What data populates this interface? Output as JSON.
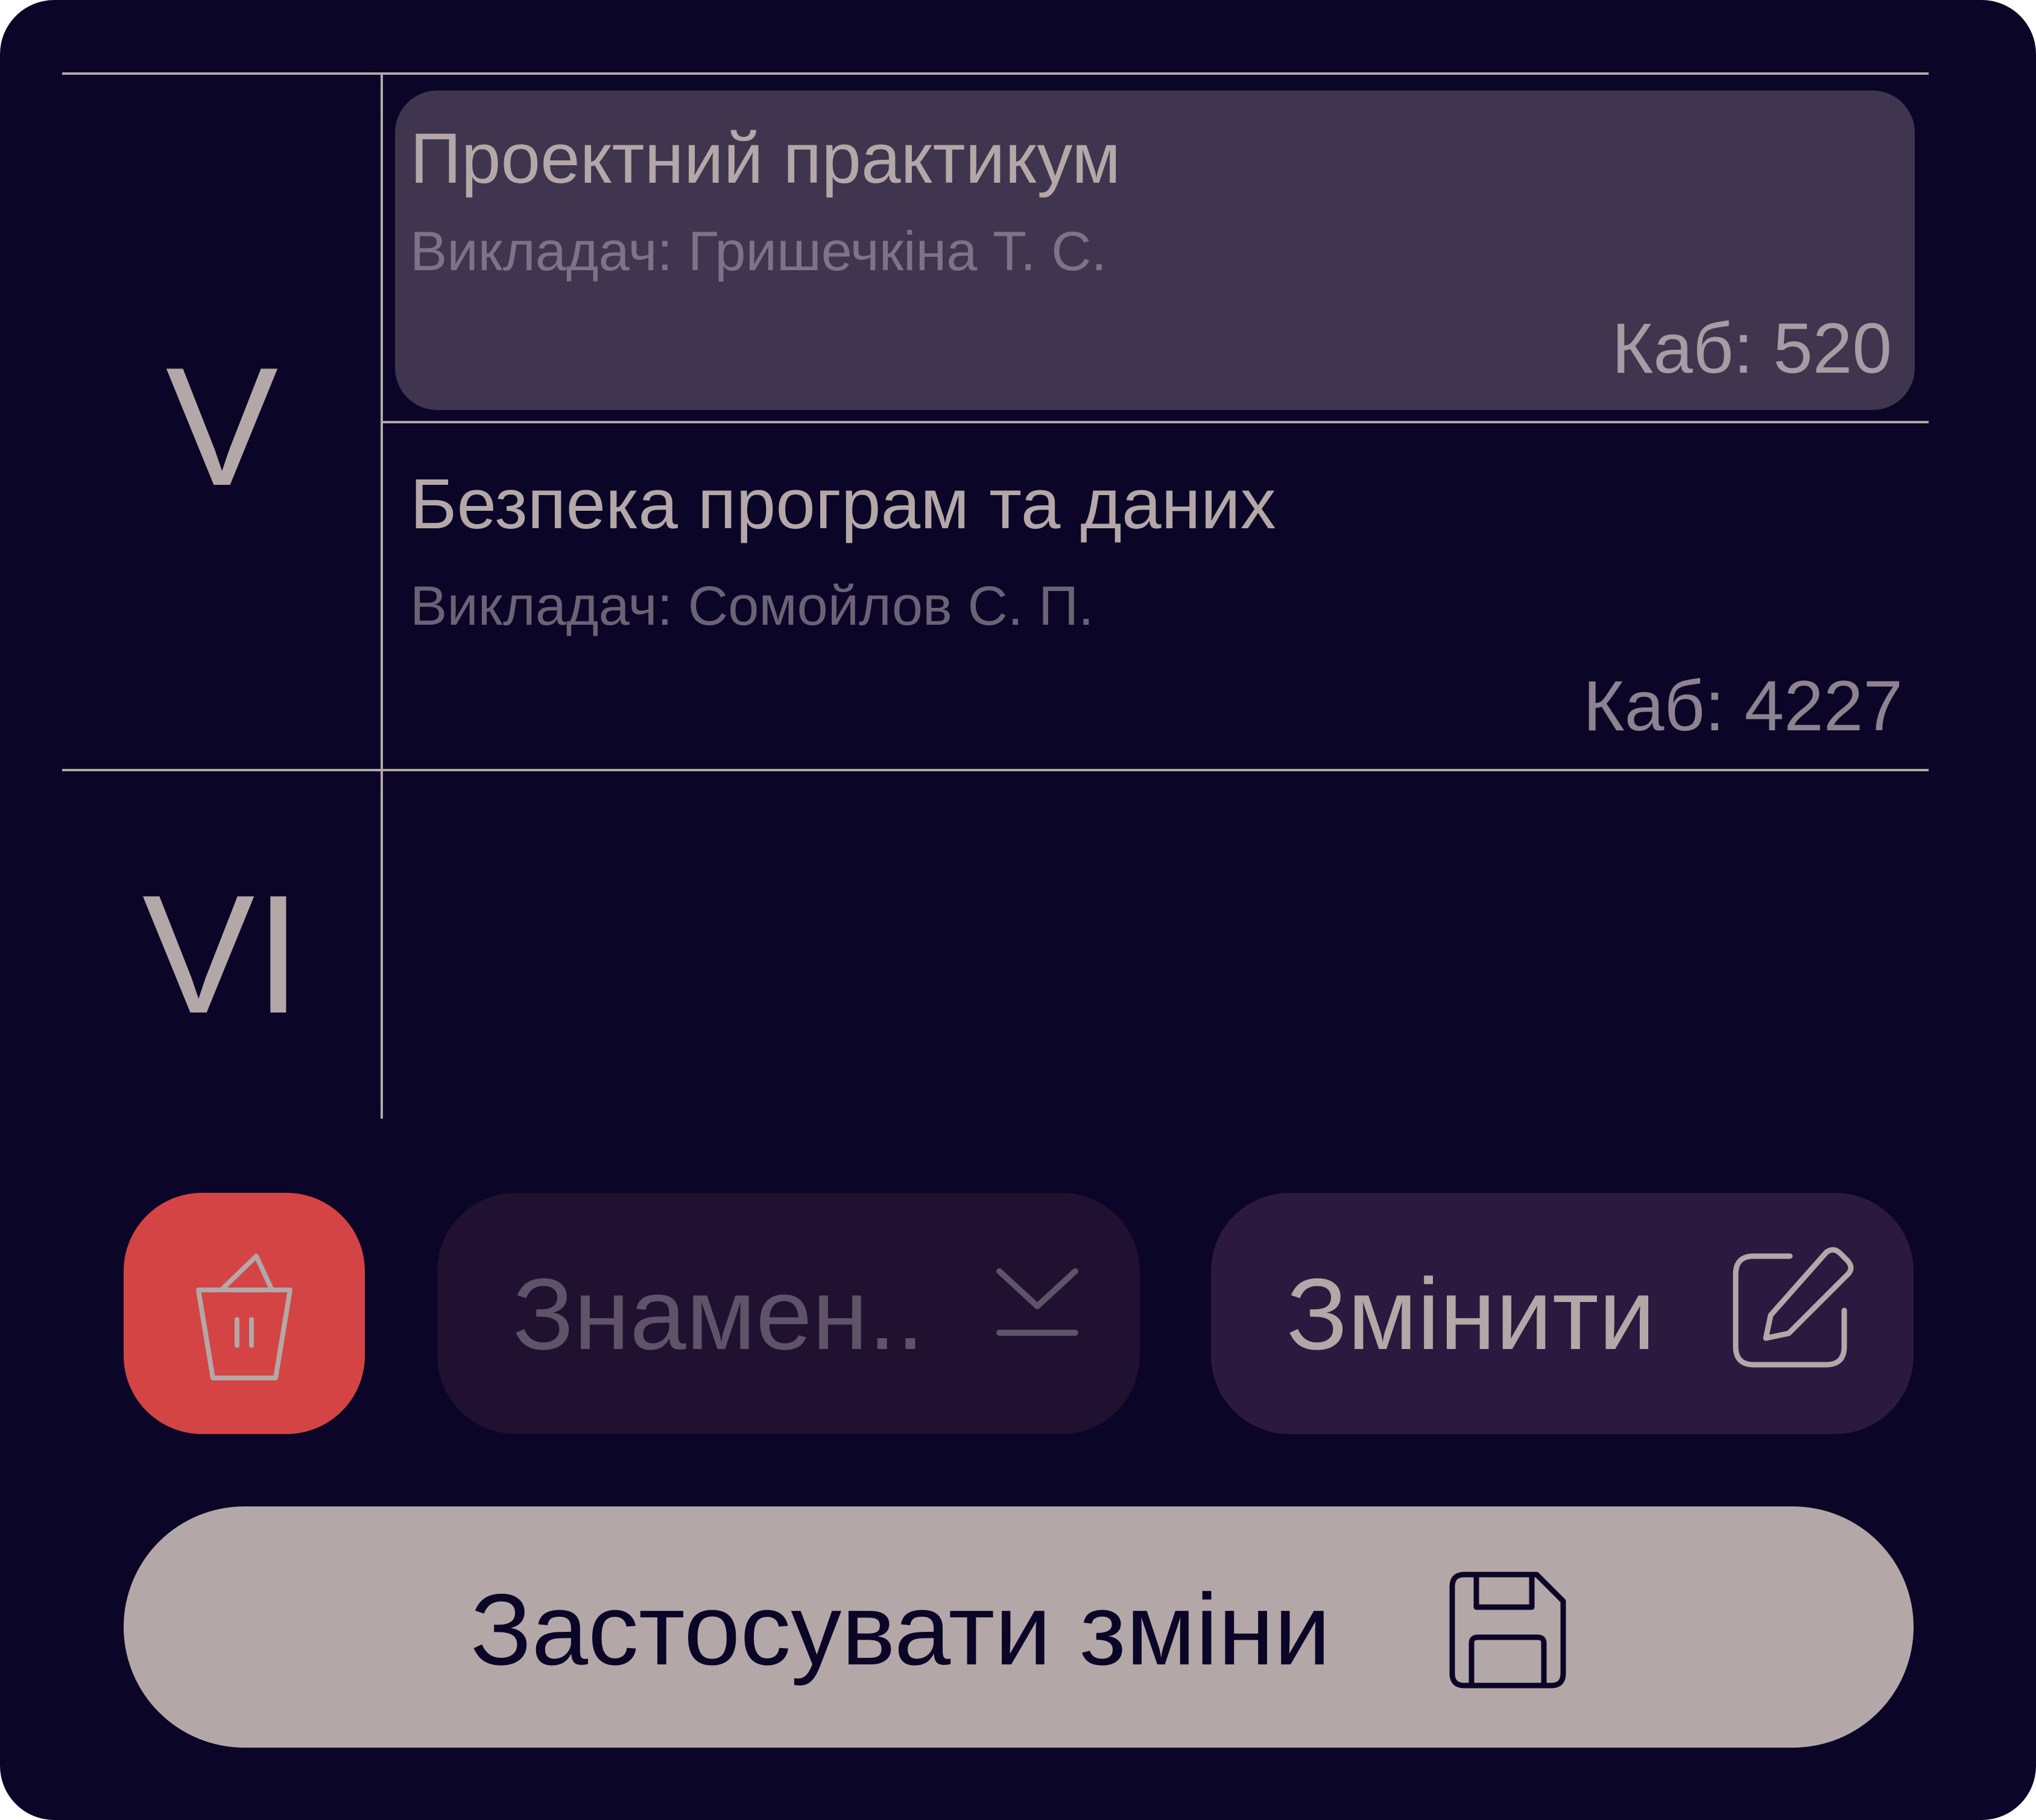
{
  "periods": [
    {
      "label": "V",
      "lessons": [
        {
          "subject": "Проектний практикум",
          "teacher": "Викладач: Гришечкіна Т. С.",
          "room": "Каб: 520",
          "selected": true
        },
        {
          "subject": "Безпека програм та даних",
          "teacher": "Викладач: Сомойлов С. П.",
          "room": "Каб: 4227",
          "selected": false
        }
      ]
    },
    {
      "label": "VI",
      "lessons": []
    }
  ],
  "actions": {
    "delete_icon": "trash-icon",
    "dropdown_label": "Знамен..",
    "dropdown_icon": "chevron-down-icon",
    "edit_label": "Змінити",
    "edit_icon": "edit-icon",
    "apply_label": "Застосувати зміни",
    "apply_icon": "save-icon"
  },
  "colors": {
    "background": "#0b0527",
    "text": "#b3a8a7",
    "selected_lesson": "#40354e",
    "delete_button": "#d54444",
    "dropdown_button": "#1f112f",
    "edit_button": "#2b193f",
    "apply_button": "#b3a8a7"
  }
}
